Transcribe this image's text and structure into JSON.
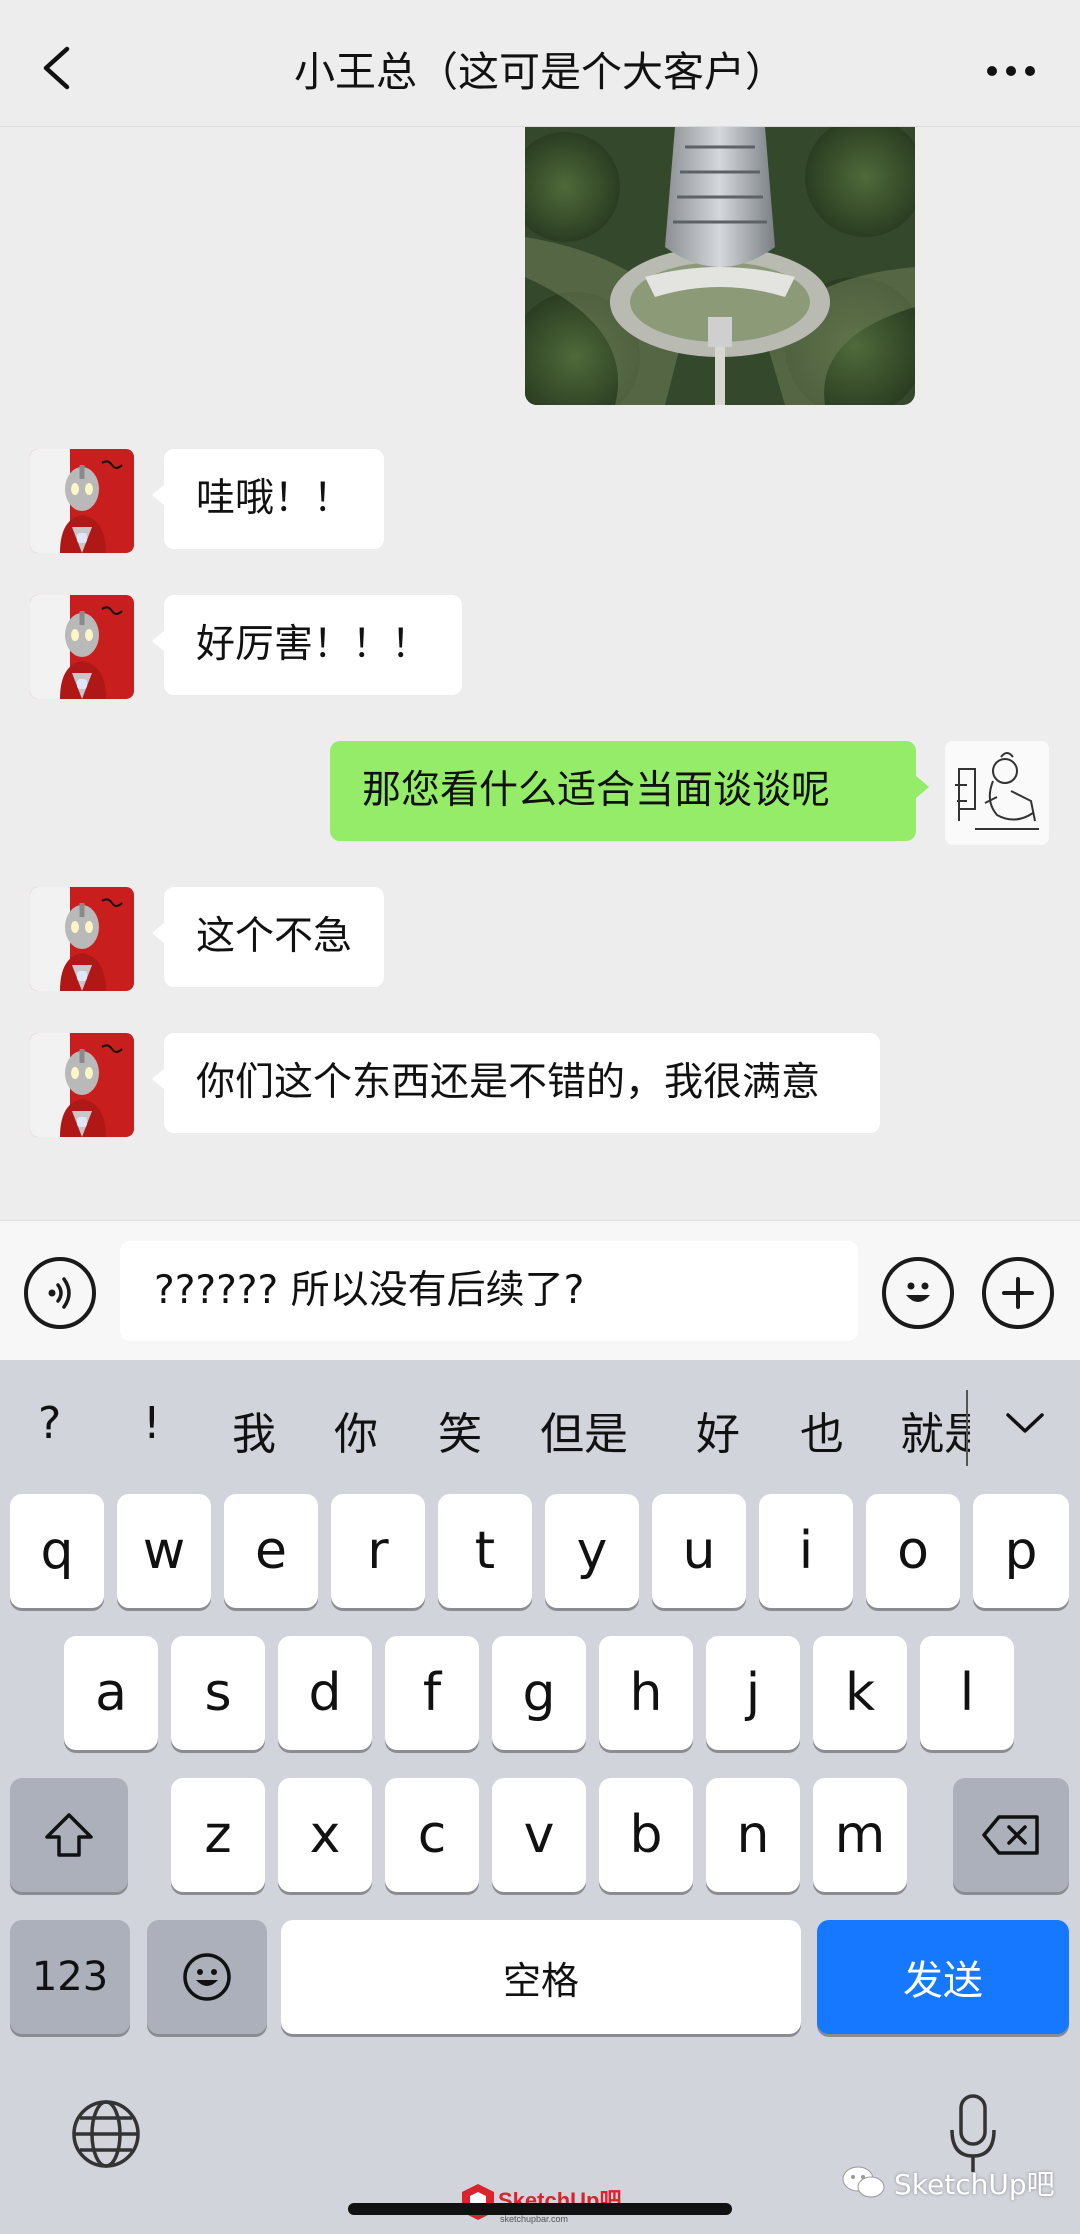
{
  "header": {
    "title": "小王总（这可是个大客户）"
  },
  "icons": {
    "back": "chevron-left-icon",
    "more": "more-dots-icon",
    "voice": "voice-icon",
    "emoji": "emoji-icon",
    "plus": "plus-icon",
    "globe": "globe-icon",
    "mic": "microphone-icon",
    "shift": "shift-icon",
    "delete": "backspace-icon",
    "collapse": "chevron-down-icon"
  },
  "messages": [
    {
      "side": "left",
      "text": "哇哦！！"
    },
    {
      "side": "left",
      "text": "好厉害！！！"
    },
    {
      "side": "right",
      "text": "那您看什么适合当面谈谈呢"
    },
    {
      "side": "left",
      "text": "这个不急"
    },
    {
      "side": "left",
      "text": "你们这个东西还是不错的，我很满意"
    }
  ],
  "input": {
    "value": "?????? 所以没有后续了?"
  },
  "keyboard": {
    "candidates": [
      "?",
      "!",
      "我",
      "你",
      "笑",
      "但是",
      "好",
      "也",
      "就是"
    ],
    "row1": [
      "q",
      "w",
      "e",
      "r",
      "t",
      "y",
      "u",
      "i",
      "o",
      "p"
    ],
    "row2": [
      "a",
      "s",
      "d",
      "f",
      "g",
      "h",
      "j",
      "k",
      "l"
    ],
    "row3": [
      "z",
      "x",
      "c",
      "v",
      "b",
      "n",
      "m"
    ],
    "num_label": "123",
    "space_label": "空格",
    "send_label": "发送"
  },
  "watermark": {
    "right": "SketchUp吧",
    "center": "SketchUp吧",
    "center_url": "sketchupbar.com"
  },
  "colors": {
    "bg": "#ededed",
    "bubble_right": "#95ec69",
    "bubble_left": "#ffffff",
    "send": "#1677ff",
    "keyboard_bg": "#d1d4db"
  }
}
